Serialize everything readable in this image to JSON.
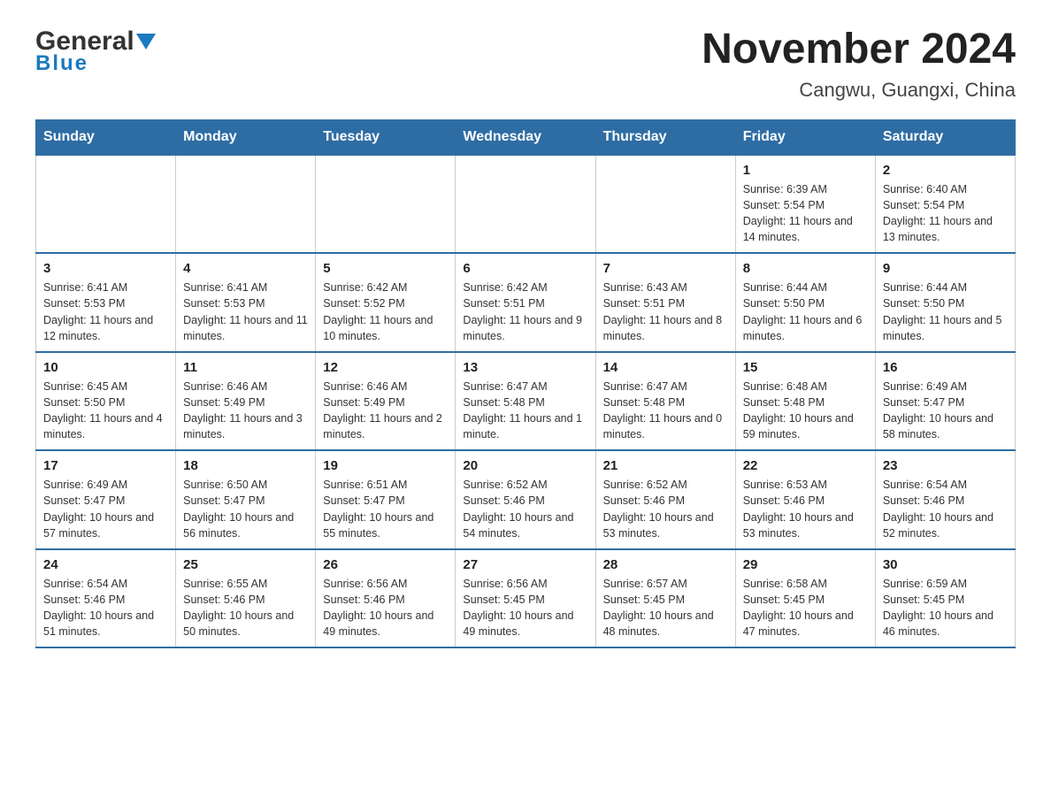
{
  "logo": {
    "general": "General",
    "blue": "Blue"
  },
  "header": {
    "title": "November 2024",
    "subtitle": "Cangwu, Guangxi, China"
  },
  "weekdays": [
    "Sunday",
    "Monday",
    "Tuesday",
    "Wednesday",
    "Thursday",
    "Friday",
    "Saturday"
  ],
  "weeks": [
    [
      {
        "day": "",
        "sunrise": "",
        "sunset": "",
        "daylight": ""
      },
      {
        "day": "",
        "sunrise": "",
        "sunset": "",
        "daylight": ""
      },
      {
        "day": "",
        "sunrise": "",
        "sunset": "",
        "daylight": ""
      },
      {
        "day": "",
        "sunrise": "",
        "sunset": "",
        "daylight": ""
      },
      {
        "day": "",
        "sunrise": "",
        "sunset": "",
        "daylight": ""
      },
      {
        "day": "1",
        "sunrise": "Sunrise: 6:39 AM",
        "sunset": "Sunset: 5:54 PM",
        "daylight": "Daylight: 11 hours and 14 minutes."
      },
      {
        "day": "2",
        "sunrise": "Sunrise: 6:40 AM",
        "sunset": "Sunset: 5:54 PM",
        "daylight": "Daylight: 11 hours and 13 minutes."
      }
    ],
    [
      {
        "day": "3",
        "sunrise": "Sunrise: 6:41 AM",
        "sunset": "Sunset: 5:53 PM",
        "daylight": "Daylight: 11 hours and 12 minutes."
      },
      {
        "day": "4",
        "sunrise": "Sunrise: 6:41 AM",
        "sunset": "Sunset: 5:53 PM",
        "daylight": "Daylight: 11 hours and 11 minutes."
      },
      {
        "day": "5",
        "sunrise": "Sunrise: 6:42 AM",
        "sunset": "Sunset: 5:52 PM",
        "daylight": "Daylight: 11 hours and 10 minutes."
      },
      {
        "day": "6",
        "sunrise": "Sunrise: 6:42 AM",
        "sunset": "Sunset: 5:51 PM",
        "daylight": "Daylight: 11 hours and 9 minutes."
      },
      {
        "day": "7",
        "sunrise": "Sunrise: 6:43 AM",
        "sunset": "Sunset: 5:51 PM",
        "daylight": "Daylight: 11 hours and 8 minutes."
      },
      {
        "day": "8",
        "sunrise": "Sunrise: 6:44 AM",
        "sunset": "Sunset: 5:50 PM",
        "daylight": "Daylight: 11 hours and 6 minutes."
      },
      {
        "day": "9",
        "sunrise": "Sunrise: 6:44 AM",
        "sunset": "Sunset: 5:50 PM",
        "daylight": "Daylight: 11 hours and 5 minutes."
      }
    ],
    [
      {
        "day": "10",
        "sunrise": "Sunrise: 6:45 AM",
        "sunset": "Sunset: 5:50 PM",
        "daylight": "Daylight: 11 hours and 4 minutes."
      },
      {
        "day": "11",
        "sunrise": "Sunrise: 6:46 AM",
        "sunset": "Sunset: 5:49 PM",
        "daylight": "Daylight: 11 hours and 3 minutes."
      },
      {
        "day": "12",
        "sunrise": "Sunrise: 6:46 AM",
        "sunset": "Sunset: 5:49 PM",
        "daylight": "Daylight: 11 hours and 2 minutes."
      },
      {
        "day": "13",
        "sunrise": "Sunrise: 6:47 AM",
        "sunset": "Sunset: 5:48 PM",
        "daylight": "Daylight: 11 hours and 1 minute."
      },
      {
        "day": "14",
        "sunrise": "Sunrise: 6:47 AM",
        "sunset": "Sunset: 5:48 PM",
        "daylight": "Daylight: 11 hours and 0 minutes."
      },
      {
        "day": "15",
        "sunrise": "Sunrise: 6:48 AM",
        "sunset": "Sunset: 5:48 PM",
        "daylight": "Daylight: 10 hours and 59 minutes."
      },
      {
        "day": "16",
        "sunrise": "Sunrise: 6:49 AM",
        "sunset": "Sunset: 5:47 PM",
        "daylight": "Daylight: 10 hours and 58 minutes."
      }
    ],
    [
      {
        "day": "17",
        "sunrise": "Sunrise: 6:49 AM",
        "sunset": "Sunset: 5:47 PM",
        "daylight": "Daylight: 10 hours and 57 minutes."
      },
      {
        "day": "18",
        "sunrise": "Sunrise: 6:50 AM",
        "sunset": "Sunset: 5:47 PM",
        "daylight": "Daylight: 10 hours and 56 minutes."
      },
      {
        "day": "19",
        "sunrise": "Sunrise: 6:51 AM",
        "sunset": "Sunset: 5:47 PM",
        "daylight": "Daylight: 10 hours and 55 minutes."
      },
      {
        "day": "20",
        "sunrise": "Sunrise: 6:52 AM",
        "sunset": "Sunset: 5:46 PM",
        "daylight": "Daylight: 10 hours and 54 minutes."
      },
      {
        "day": "21",
        "sunrise": "Sunrise: 6:52 AM",
        "sunset": "Sunset: 5:46 PM",
        "daylight": "Daylight: 10 hours and 53 minutes."
      },
      {
        "day": "22",
        "sunrise": "Sunrise: 6:53 AM",
        "sunset": "Sunset: 5:46 PM",
        "daylight": "Daylight: 10 hours and 53 minutes."
      },
      {
        "day": "23",
        "sunrise": "Sunrise: 6:54 AM",
        "sunset": "Sunset: 5:46 PM",
        "daylight": "Daylight: 10 hours and 52 minutes."
      }
    ],
    [
      {
        "day": "24",
        "sunrise": "Sunrise: 6:54 AM",
        "sunset": "Sunset: 5:46 PM",
        "daylight": "Daylight: 10 hours and 51 minutes."
      },
      {
        "day": "25",
        "sunrise": "Sunrise: 6:55 AM",
        "sunset": "Sunset: 5:46 PM",
        "daylight": "Daylight: 10 hours and 50 minutes."
      },
      {
        "day": "26",
        "sunrise": "Sunrise: 6:56 AM",
        "sunset": "Sunset: 5:46 PM",
        "daylight": "Daylight: 10 hours and 49 minutes."
      },
      {
        "day": "27",
        "sunrise": "Sunrise: 6:56 AM",
        "sunset": "Sunset: 5:45 PM",
        "daylight": "Daylight: 10 hours and 49 minutes."
      },
      {
        "day": "28",
        "sunrise": "Sunrise: 6:57 AM",
        "sunset": "Sunset: 5:45 PM",
        "daylight": "Daylight: 10 hours and 48 minutes."
      },
      {
        "day": "29",
        "sunrise": "Sunrise: 6:58 AM",
        "sunset": "Sunset: 5:45 PM",
        "daylight": "Daylight: 10 hours and 47 minutes."
      },
      {
        "day": "30",
        "sunrise": "Sunrise: 6:59 AM",
        "sunset": "Sunset: 5:45 PM",
        "daylight": "Daylight: 10 hours and 46 minutes."
      }
    ]
  ]
}
